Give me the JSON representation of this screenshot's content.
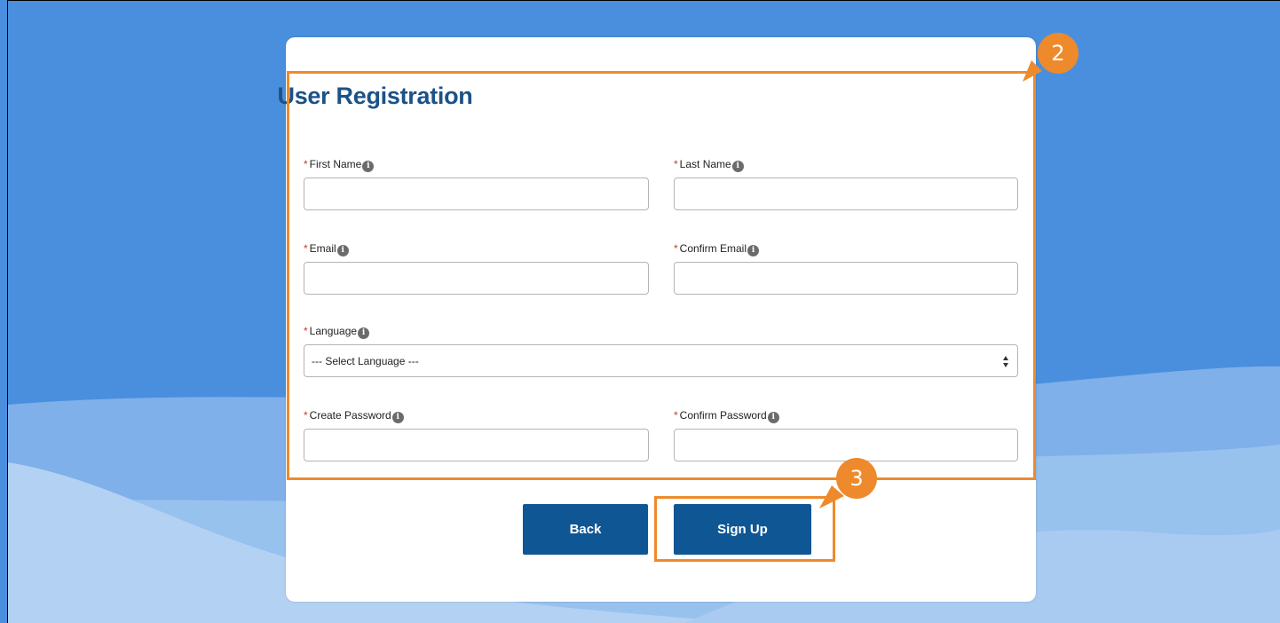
{
  "form": {
    "title": "User Registration",
    "required_marker": "*",
    "info_glyph": "i",
    "fields": {
      "first_name": {
        "label": "First Name",
        "value": ""
      },
      "last_name": {
        "label": "Last Name",
        "value": ""
      },
      "email": {
        "label": "Email",
        "value": ""
      },
      "confirm_email": {
        "label": "Confirm Email",
        "value": ""
      },
      "language": {
        "label": "Language",
        "selected": "--- Select Language ---"
      },
      "create_password": {
        "label": "Create Password",
        "value": ""
      },
      "confirm_password": {
        "label": "Confirm Password",
        "value": ""
      }
    }
  },
  "buttons": {
    "back": "Back",
    "sign_up": "Sign Up"
  },
  "callouts": {
    "form_region": "2",
    "sign_up_button": "3"
  },
  "colors": {
    "background": "#4a8fde",
    "title": "#1b5287",
    "button": "#0f5694",
    "highlight": "#ee8a2c",
    "required": "#c23934"
  }
}
